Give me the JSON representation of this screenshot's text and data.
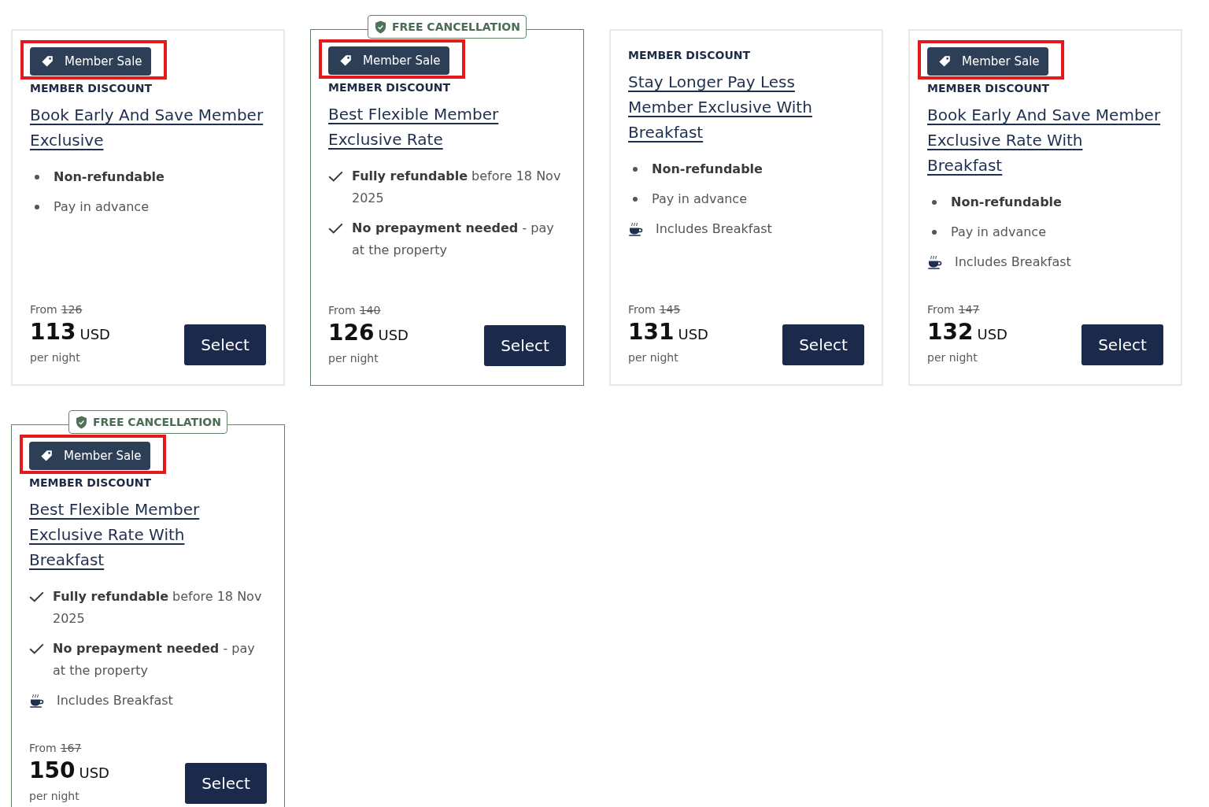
{
  "cards": [
    {
      "badge": {
        "label": "Member Sale",
        "highlighted": true
      },
      "category": "MEMBER DISCOUNT",
      "title": "Book Early And Save Member Exclusive",
      "features": [
        {
          "kind": "bullet",
          "text": "Non-refundable",
          "strong": true
        },
        {
          "kind": "bullet",
          "text": "Pay in advance",
          "strong": false
        }
      ],
      "price": {
        "from_label": "From",
        "old_price": "126",
        "amount": "113",
        "currency": "USD",
        "unit": "per night"
      },
      "button": "Select"
    },
    {
      "tag": {
        "label": "FREE CANCELLATION"
      },
      "badge": {
        "label": "Member Sale",
        "highlighted": true
      },
      "category": "MEMBER DISCOUNT",
      "title": "Best Flexible Member Exclusive Rate",
      "features": [
        {
          "kind": "check",
          "text": "**Fully refundable** before 18 Nov 2025",
          "strong": false
        },
        {
          "kind": "check",
          "text": "**No prepayment needed** - pay at the property",
          "strong": false
        }
      ],
      "price": {
        "from_label": "From",
        "old_price": "140",
        "amount": "126",
        "currency": "USD",
        "unit": "per night"
      },
      "button": "Select"
    },
    {
      "category": "MEMBER DISCOUNT",
      "title": "Stay Longer Pay Less Member Exclusive With Breakfast",
      "features": [
        {
          "kind": "bullet",
          "text": "Non-refundable",
          "strong": true
        },
        {
          "kind": "bullet",
          "text": "Pay in advance",
          "strong": false
        },
        {
          "kind": "breakfast",
          "text": "Includes Breakfast",
          "strong": false
        }
      ],
      "price": {
        "from_label": "From",
        "old_price": "145",
        "amount": "131",
        "currency": "USD",
        "unit": "per night"
      },
      "button": "Select"
    },
    {
      "badge": {
        "label": "Member Sale",
        "highlighted": true
      },
      "category": "MEMBER DISCOUNT",
      "title": "Book Early And Save Member Exclusive Rate With Breakfast",
      "features": [
        {
          "kind": "bullet",
          "text": "Non-refundable",
          "strong": true
        },
        {
          "kind": "bullet",
          "text": "Pay in advance",
          "strong": false
        },
        {
          "kind": "breakfast",
          "text": "Includes Breakfast",
          "strong": false
        }
      ],
      "price": {
        "from_label": "From",
        "old_price": "147",
        "amount": "132",
        "currency": "USD",
        "unit": "per night"
      },
      "button": "Select"
    },
    {
      "tag": {
        "label": "FREE CANCELLATION"
      },
      "badge": {
        "label": "Member Sale",
        "highlighted": true
      },
      "category": "MEMBER DISCOUNT",
      "title": "Best Flexible Member Exclusive Rate With Breakfast",
      "features": [
        {
          "kind": "check",
          "text": "**Fully refundable** before 18 Nov 2025",
          "strong": false
        },
        {
          "kind": "check",
          "text": "**No prepayment needed** - pay at the property",
          "strong": false
        },
        {
          "kind": "breakfast",
          "text": "Includes Breakfast",
          "strong": false
        }
      ],
      "price": {
        "from_label": "From",
        "old_price": "167",
        "amount": "150",
        "currency": "USD",
        "unit": "per night"
      },
      "button": "Select"
    }
  ]
}
